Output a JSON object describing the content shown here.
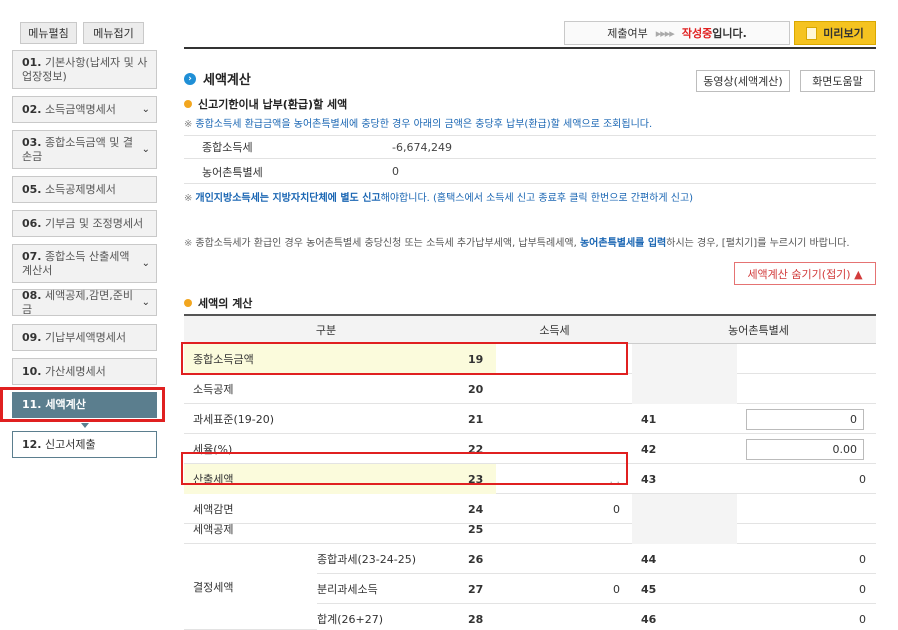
{
  "sidebar": {
    "menu_open": "메뉴펼침",
    "menu_close": "메뉴접기",
    "items": [
      {
        "num": "01.",
        "label": "기본사항(납세자 및 사업장정보)",
        "caret": ""
      },
      {
        "num": "02.",
        "label": "소득금액명세서",
        "caret": "⌄"
      },
      {
        "num": "03.",
        "label": "종합소득금액 및 결손금",
        "caret": "⌄"
      },
      {
        "num": "05.",
        "label": "소득공제명세서",
        "caret": ""
      },
      {
        "num": "06.",
        "label": "기부금 및 조정명세서",
        "caret": ""
      },
      {
        "num": "07.",
        "label": "종합소득 산출세액계산서",
        "caret": "⌄"
      },
      {
        "num": "08.",
        "label": "세액공제,감면,준비금",
        "caret": "⌄"
      },
      {
        "num": "09.",
        "label": "기납부세액명세서",
        "caret": ""
      },
      {
        "num": "10.",
        "label": "가산세명세서",
        "caret": ""
      },
      {
        "num": "11.",
        "label": "세액계산",
        "caret": ""
      },
      {
        "num": "12.",
        "label": "신고서제출",
        "caret": ""
      }
    ]
  },
  "topbar": {
    "submit_label": "제출여부",
    "arrows": "▸▸▸▸",
    "state": "작성중",
    "state_suffix": "입니다.",
    "preview_label": "미리보기"
  },
  "section": {
    "title": "세액계산",
    "video_button": "동영상(세액계산)",
    "help_button": "화면도움말",
    "subtitle1": "신고기한이내 납부(환급)할 세액",
    "note1": "종합소득세 환급금액을 농어촌특별세에 충당한 경우 아래의 금액은 충당후 납부(환급)할 세액으로 조회됩니다.",
    "rows": [
      {
        "label": "종합소득세",
        "value": "-6,674,249"
      },
      {
        "label": "농어촌특별세",
        "value": "0"
      }
    ],
    "note2_bold": "개인지방소득세는 지방자치단체에 별도 신고",
    "note2_rest": "해야합니다. (홈택스에서 소득세 신고 종료후 클릭 한번으로 간편하게 신고)",
    "note3_a": "종합소득세가 환급인 경우 농어촌특별세 충당신청 또는 소득세 추가납부세액, 납부특례세액, ",
    "note3_bold": "농어촌특별세를 입력",
    "note3_b": "하시는 경우, [펼치기]를 누르시기 바랍니다.",
    "toggle_button": "세액계산 숨기기(접기) ▲",
    "subtitle2": "세액의 계산"
  },
  "calc_table": {
    "headers": [
      "구분",
      "소득세",
      "농어촌특별세"
    ],
    "rows": [
      {
        "label": "종합소득금액",
        "sub": "",
        "n1": "19",
        "v1": "",
        "n2": "",
        "v2": ""
      },
      {
        "label": "소득공제",
        "sub": "",
        "n1": "20",
        "v1": "",
        "n2": "",
        "v2": ""
      },
      {
        "label": "과세표준(19-20)",
        "sub": "",
        "n1": "21",
        "v1": "",
        "n2": "41",
        "v2": "0"
      },
      {
        "label": "세율(%)",
        "sub": "",
        "n1": "22",
        "v1": "",
        "n2": "42",
        "v2": "0.00"
      },
      {
        "label": "산출세액",
        "sub": "",
        "n1": "23",
        "v1": ".       .",
        "n2": "43",
        "v2": "0"
      },
      {
        "label": "세액감면",
        "sub": "",
        "n1": "24",
        "v1": "0",
        "n2": "",
        "v2": ""
      },
      {
        "label": "세액공제",
        "sub": "",
        "n1": "25",
        "v1": "",
        "n2": "",
        "v2": ""
      },
      {
        "label": "",
        "sub": "종합과세(23-24-25)",
        "n1": "26",
        "v1": "",
        "n2": "44",
        "v2": "0"
      },
      {
        "label": "결정세액",
        "sub": "분리과세소득",
        "n1": "27",
        "v1": "0",
        "n2": "45",
        "v2": "0"
      },
      {
        "label": "",
        "sub": "합계(26+27)",
        "n1": "28",
        "v1": "",
        "n2": "46",
        "v2": "0"
      }
    ]
  }
}
